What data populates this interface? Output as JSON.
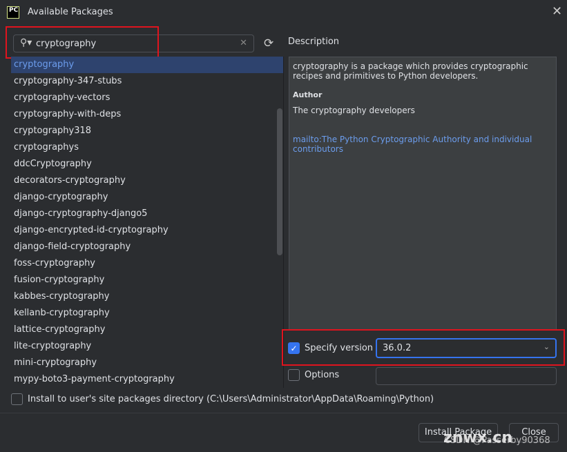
{
  "window": {
    "title": "Available Packages",
    "logo": "PC",
    "close_icon": "close-icon"
  },
  "search": {
    "value": "cryptography"
  },
  "packages": [
    "cryptography",
    "cryptography-347-stubs",
    "cryptography-vectors",
    "cryptography-with-deps",
    "cryptography318",
    "cryptographys",
    "ddcCryptography",
    "decorators-cryptography",
    "django-cryptography",
    "django-cryptography-django5",
    "django-encrypted-id-cryptography",
    "django-field-cryptography",
    "foss-cryptography",
    "fusion-cryptography",
    "kabbes-cryptography",
    "kellanb-cryptography",
    "lattice-cryptography",
    "lite-cryptography",
    "mini-cryptography",
    "mypy-boto3-payment-cryptography"
  ],
  "selected_index": 0,
  "description": {
    "label": "Description",
    "text": "cryptography is a package which provides cryptographic recipes and primitives to Python developers.",
    "author_label": "Author",
    "author": "The cryptography developers",
    "link": "mailto:The Python Cryptographic Authority and individual contributors"
  },
  "version": {
    "label": "Specify version",
    "checked": true,
    "value": "36.0.2"
  },
  "options": {
    "label": "Options",
    "checked": false,
    "value": ""
  },
  "user_site": {
    "label": "Install to user's site packages directory (C:\\Users\\Administrator\\AppData\\Roaming\\Python)",
    "checked": false
  },
  "buttons": {
    "install": "Install Package",
    "close": "Close"
  },
  "watermark": {
    "main": "znwx.cn",
    "sub": "CSDN @Passerby90368"
  },
  "colors": {
    "accent": "#3574f0",
    "highlight": "#e0141e",
    "link": "#6c9ded"
  }
}
